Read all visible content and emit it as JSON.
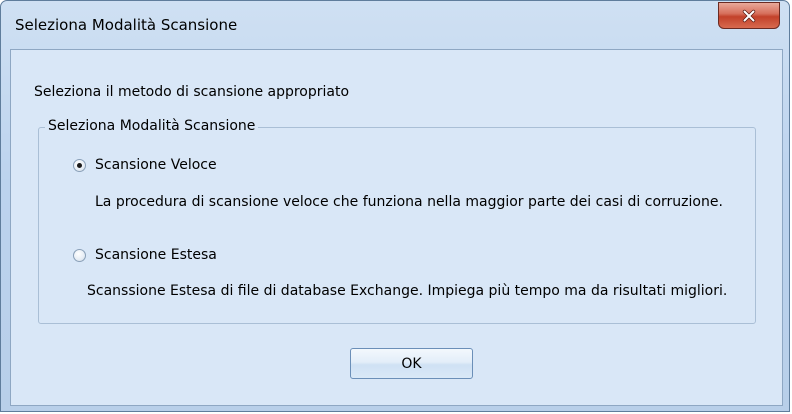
{
  "window": {
    "title": "Seleziona Modalità Scansione"
  },
  "instruction": "Seleziona il metodo di scansione appropriato",
  "group": {
    "label": "Seleziona Modalità Scansione",
    "options": [
      {
        "label": "Scansione Veloce",
        "description": "La procedura di scansione veloce che funziona nella maggior parte dei casi di corruzione.",
        "selected": true
      },
      {
        "label": "Scansione Estesa",
        "description": "Scanssione Estesa di file di database Exchange. Impiega più tempo ma da risultati migliori.",
        "selected": false
      }
    ]
  },
  "buttons": {
    "ok_label": "OK"
  },
  "icons": {
    "close": "close-icon",
    "radio": "radio-button"
  },
  "colors": {
    "window_frame": "#bcd3ee",
    "client_background": "#d9e7f7",
    "close_button": "#c2412a"
  }
}
